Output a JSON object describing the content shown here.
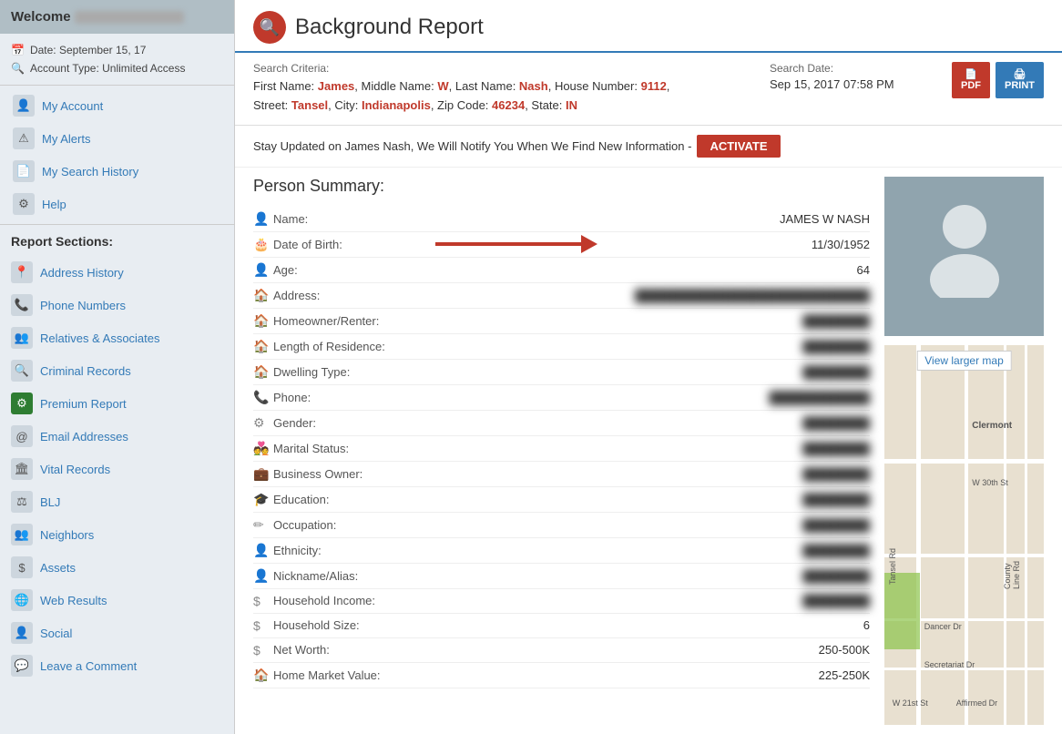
{
  "sidebar": {
    "welcome_label": "Welcome",
    "date_label": "Date: September 15, 17",
    "account_type_label": "Account Type: Unlimited Access",
    "nav": [
      {
        "id": "account",
        "label": "My Account",
        "icon": "👤"
      },
      {
        "id": "alerts",
        "label": "My Alerts",
        "icon": "⚠"
      },
      {
        "id": "search-history",
        "label": "My Search History",
        "icon": "📄"
      },
      {
        "id": "help",
        "label": "Help",
        "icon": "⚙"
      }
    ],
    "report_sections_title": "Report Sections:",
    "sections": [
      {
        "id": "address-history",
        "label": "Address History",
        "icon": "📍",
        "green": false
      },
      {
        "id": "phone-numbers",
        "label": "Phone Numbers",
        "icon": "📞",
        "green": false
      },
      {
        "id": "relatives",
        "label": "Relatives & Associates",
        "icon": "👥",
        "green": false
      },
      {
        "id": "criminal",
        "label": "Criminal Records",
        "icon": "🔍",
        "green": false
      },
      {
        "id": "premium",
        "label": "Premium Report",
        "icon": "⚙",
        "green": true
      },
      {
        "id": "email",
        "label": "Email Addresses",
        "icon": "@",
        "green": false
      },
      {
        "id": "vital",
        "label": "Vital Records",
        "icon": "🏛",
        "green": false
      },
      {
        "id": "blj",
        "label": "BLJ",
        "icon": "⚖",
        "green": false
      },
      {
        "id": "neighbors",
        "label": "Neighbors",
        "icon": "👥",
        "green": false
      },
      {
        "id": "assets",
        "label": "Assets",
        "icon": "$",
        "green": false
      },
      {
        "id": "web",
        "label": "Web Results",
        "icon": "🌐",
        "green": false
      },
      {
        "id": "social",
        "label": "Social",
        "icon": "👤",
        "green": false
      },
      {
        "id": "comment",
        "label": "Leave a Comment",
        "icon": "💬",
        "green": false
      }
    ]
  },
  "header": {
    "title": "Background Report",
    "search_criteria_label": "Search Criteria:",
    "criteria": {
      "first_name_label": "First Name:",
      "first_name": "James",
      "middle_name_label": "Middle Name:",
      "middle_name": "W",
      "last_name_label": "Last Name:",
      "last_name": "Nash",
      "house_number_label": "House Number:",
      "house_number": "9112",
      "street_label": "Street:",
      "street": "Tansel",
      "city_label": "City:",
      "city": "Indianapolis",
      "zip_label": "Zip Code:",
      "zip": "46234",
      "state_label": "State:",
      "state": "IN"
    },
    "search_date_label": "Search Date:",
    "search_date": "Sep 15, 2017 07:58 PM",
    "pdf_label": "PDF",
    "print_label": "PRINT"
  },
  "notification": {
    "text": "Stay Updated on James Nash, We Will Notify You When We Find New Information -",
    "activate_label": "ACTIVATE"
  },
  "person_summary": {
    "title": "Person Summary:",
    "fields": [
      {
        "label": "Name:",
        "value": "JAMES W NASH",
        "blurred": false,
        "icon": "👤"
      },
      {
        "label": "Date of Birth:",
        "value": "11/30/1952",
        "blurred": false,
        "icon": "🎂",
        "has_arrow": true
      },
      {
        "label": "Age:",
        "value": "64",
        "blurred": false,
        "icon": "👤"
      },
      {
        "label": "Address:",
        "value": "██████████████████████",
        "blurred": true,
        "icon": "🏠"
      },
      {
        "label": "Homeowner/Renter:",
        "value": "██████",
        "blurred": true,
        "icon": "🏠"
      },
      {
        "label": "Length of Residence:",
        "value": "██████",
        "blurred": true,
        "icon": "🏠"
      },
      {
        "label": "Dwelling Type:",
        "value": "██████",
        "blurred": true,
        "icon": "🏠"
      },
      {
        "label": "Phone:",
        "value": "██████████",
        "blurred": true,
        "icon": "📞"
      },
      {
        "label": "Gender:",
        "value": "██████",
        "blurred": true,
        "icon": "⚙"
      },
      {
        "label": "Marital Status:",
        "value": "██████",
        "blurred": true,
        "icon": "💑"
      },
      {
        "label": "Business Owner:",
        "value": "██████",
        "blurred": true,
        "icon": "💼"
      },
      {
        "label": "Education:",
        "value": "██████",
        "blurred": true,
        "icon": "🎓"
      },
      {
        "label": "Occupation:",
        "value": "██████",
        "blurred": true,
        "icon": "✏"
      },
      {
        "label": "Ethnicity:",
        "value": "██████",
        "blurred": true,
        "icon": "👤"
      },
      {
        "label": "Nickname/Alias:",
        "value": "██████",
        "blurred": true,
        "icon": "👤"
      },
      {
        "label": "Household Income:",
        "value": "██████",
        "blurred": true,
        "icon": "$"
      },
      {
        "label": "Household Size:",
        "value": "6",
        "blurred": false,
        "icon": "$"
      },
      {
        "label": "Net Worth:",
        "value": "250-500K",
        "blurred": false,
        "icon": "$"
      },
      {
        "label": "Home Market Value:",
        "value": "225-250K",
        "blurred": false,
        "icon": "🏠"
      }
    ]
  },
  "map": {
    "view_larger_label": "View larger map"
  }
}
